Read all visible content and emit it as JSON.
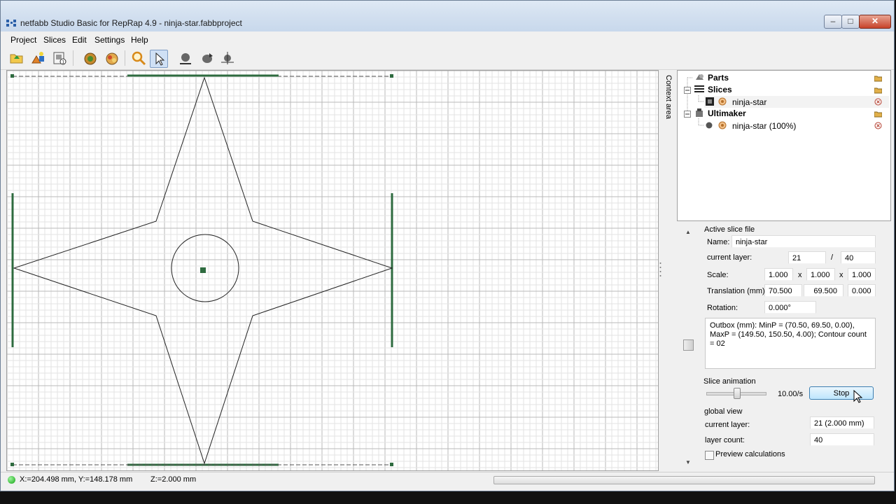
{
  "window": {
    "title": "netfabb Studio Basic for RepRap 4.9 - ninja-star.fabbproject"
  },
  "menu": [
    "Project",
    "Slices",
    "Edit",
    "Settings",
    "Help"
  ],
  "toolbar": [
    "open-icon",
    "add-part-icon",
    "new-slice-icon",
    "repair-icon",
    "analysis-icon",
    "zoom-icon",
    "select-cursor-icon",
    "view-bottom-icon",
    "view-rotate-icon",
    "view-axes-icon"
  ],
  "context_area_label": "Context area",
  "tree": {
    "parts_label": "Parts",
    "slices_label": "Slices",
    "slice_item": "ninja-star",
    "machine_label": "Ultimaker",
    "machine_item": "ninja-star (100%)"
  },
  "props": {
    "section_title": "Active slice file",
    "name_label": "Name:",
    "name_value": "ninja-star",
    "layer_label": "current layer:",
    "layer_value": "21",
    "layer_sep": "/",
    "layer_total": "40",
    "scale_label": "Scale:",
    "scale": [
      "1.000",
      "1.000",
      "1.000"
    ],
    "x_sep": "x",
    "translation_label": "Translation (mm):",
    "translation": [
      "70.500",
      "69.500",
      "0.000"
    ],
    "rotation_label": "Rotation:",
    "rotation_value": "0.000°",
    "outbox_text": "Outbox (mm): MinP = (70.50, 69.50, 0.00), MaxP = (149.50, 150.50, 4.00); Contour count = 02",
    "animation_title": "Slice animation",
    "animation_speed": "10.00/s",
    "animation_slider_fraction": 0.5,
    "stop_label": "Stop",
    "global_title": "global view",
    "global_layer_label": "current layer:",
    "global_layer_value": "21 (2.000 mm)",
    "layer_count_label": "layer count:",
    "layer_count_value": "40",
    "preview_label": "Preview calculations",
    "preview_checked": false
  },
  "status": {
    "xy": "X:=204.498 mm, Y:=148.178 mm",
    "z": "Z:=2.000 mm"
  },
  "colors": {
    "accent": "#2e6b3f",
    "selection": "#cfe0f5"
  }
}
